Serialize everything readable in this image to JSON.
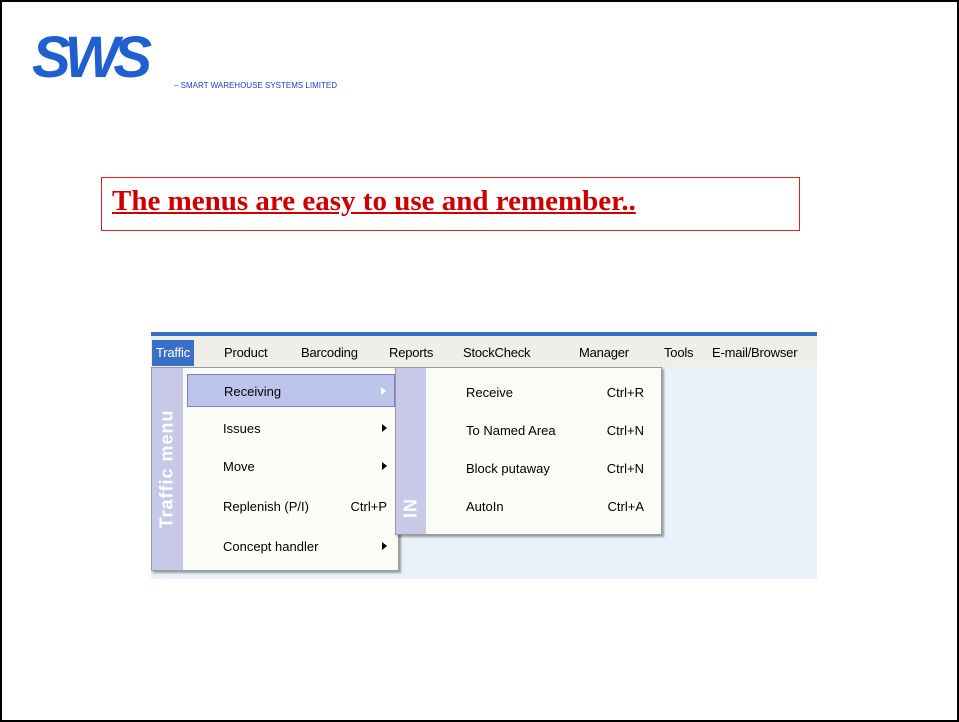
{
  "logo": {
    "mark_text": "SWS",
    "tagline": "– SMART WAREHOUSE SYSTEMS LIMITED"
  },
  "headline": "The menus are easy to use and remember..",
  "menubar": {
    "items": [
      {
        "label": "Traffic",
        "active": true
      },
      {
        "label": "Product"
      },
      {
        "label": "Barcoding"
      },
      {
        "label": "Reports"
      },
      {
        "label": "StockCheck"
      },
      {
        "label": "Manager"
      },
      {
        "label": "Tools"
      },
      {
        "label": "E-mail/Browser"
      }
    ]
  },
  "traffic_menu": {
    "side_label": "Traffic menu",
    "items": [
      {
        "label": "Receiving",
        "submenu": true,
        "selected": true
      },
      {
        "label": "Issues",
        "submenu": true
      },
      {
        "label": "Move",
        "submenu": true
      },
      {
        "label": "Replenish (P/I)",
        "shortcut": "Ctrl+P"
      },
      {
        "label": "Concept handler",
        "submenu": true
      }
    ]
  },
  "in_menu": {
    "side_label": "IN",
    "items": [
      {
        "label": "Receive",
        "shortcut": "Ctrl+R"
      },
      {
        "label": "To Named Area",
        "shortcut": "Ctrl+N"
      },
      {
        "label": "Block putaway",
        "shortcut": "Ctrl+N"
      },
      {
        "label": "AutoIn",
        "shortcut": "Ctrl+A"
      }
    ]
  },
  "colors": {
    "logo_blue": "#1f5fd0",
    "headline_red": "#d00000",
    "menubar_accent": "#3a6fc8",
    "menu_side": "#c8c8e8"
  }
}
